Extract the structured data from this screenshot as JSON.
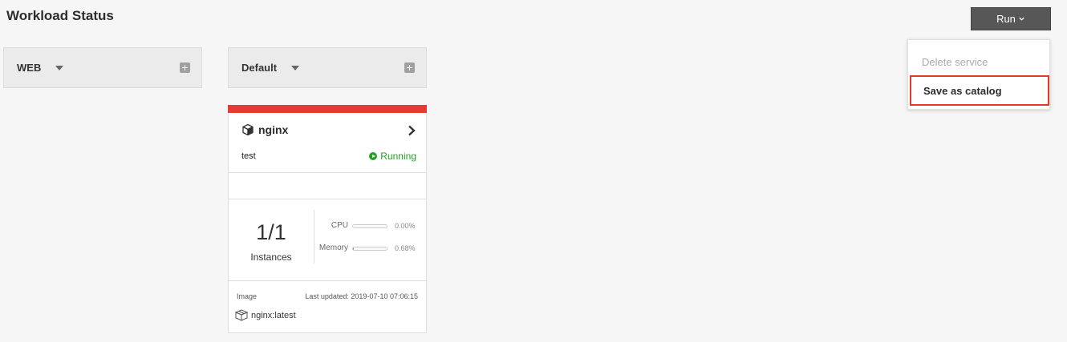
{
  "header": {
    "title": "Workload Status",
    "run_label": "Run"
  },
  "groups": [
    {
      "name": "WEB"
    },
    {
      "name": "Default"
    }
  ],
  "menu": {
    "items": [
      {
        "label": "Delete service",
        "disabled": true
      },
      {
        "label": "Save as catalog",
        "highlighted": true
      }
    ]
  },
  "service": {
    "name": "nginx",
    "description": "test",
    "status": "Running",
    "stripe_color": "#e53a35",
    "status_color": "#24a024",
    "instances": "1/1",
    "instances_label": "Instances",
    "cpu_label": "CPU",
    "cpu_value": "0.00%",
    "cpu_fraction": 0.0,
    "memory_label": "Memory",
    "memory_value": "0.68%",
    "memory_fraction": 0.0068,
    "image_label": "Image",
    "last_updated": "Last updated: 2019-07-10 07:06:15",
    "image_name": "nginx:latest"
  },
  "icons": {
    "service": "cube-icon",
    "image": "box-icon",
    "open": "chevron-right-icon",
    "status": "play-circle-icon",
    "add": "plus-square-icon",
    "caret": "caret-down-icon"
  }
}
